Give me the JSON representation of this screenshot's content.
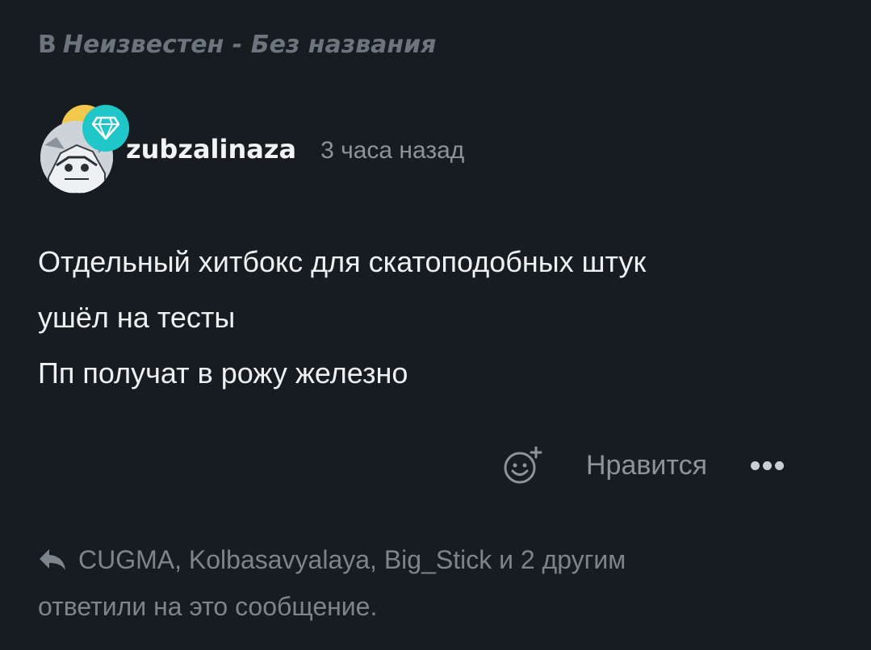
{
  "channel": {
    "prefix": "В",
    "name": "Неизвестен - Без названия"
  },
  "post": {
    "author": "zubzalinaza",
    "time": "3 часа назад",
    "avatar_icon": "avatar-image",
    "badge_icon": "diamond-icon",
    "lines": [
      "Отдельный хитбокс для скатоподобных штук",
      "ушёл на тесты",
      "Пп получат в рожу железно"
    ]
  },
  "actions": {
    "react_icon": "add-reaction-icon",
    "like_label": "Нравится",
    "more_icon": "more-dots-icon"
  },
  "replies": {
    "icon": "reply-arrow-icon",
    "line1": "CUGMA, Kolbasavyalaya, Big_Stick и 2 другим",
    "line2": "ответили на это сообщение."
  },
  "colors": {
    "background": "#161c20",
    "text": "#eef1f3",
    "muted": "#8c949b",
    "badge_teal": "#20c7c9",
    "badge_gold": "#f2c94c"
  }
}
